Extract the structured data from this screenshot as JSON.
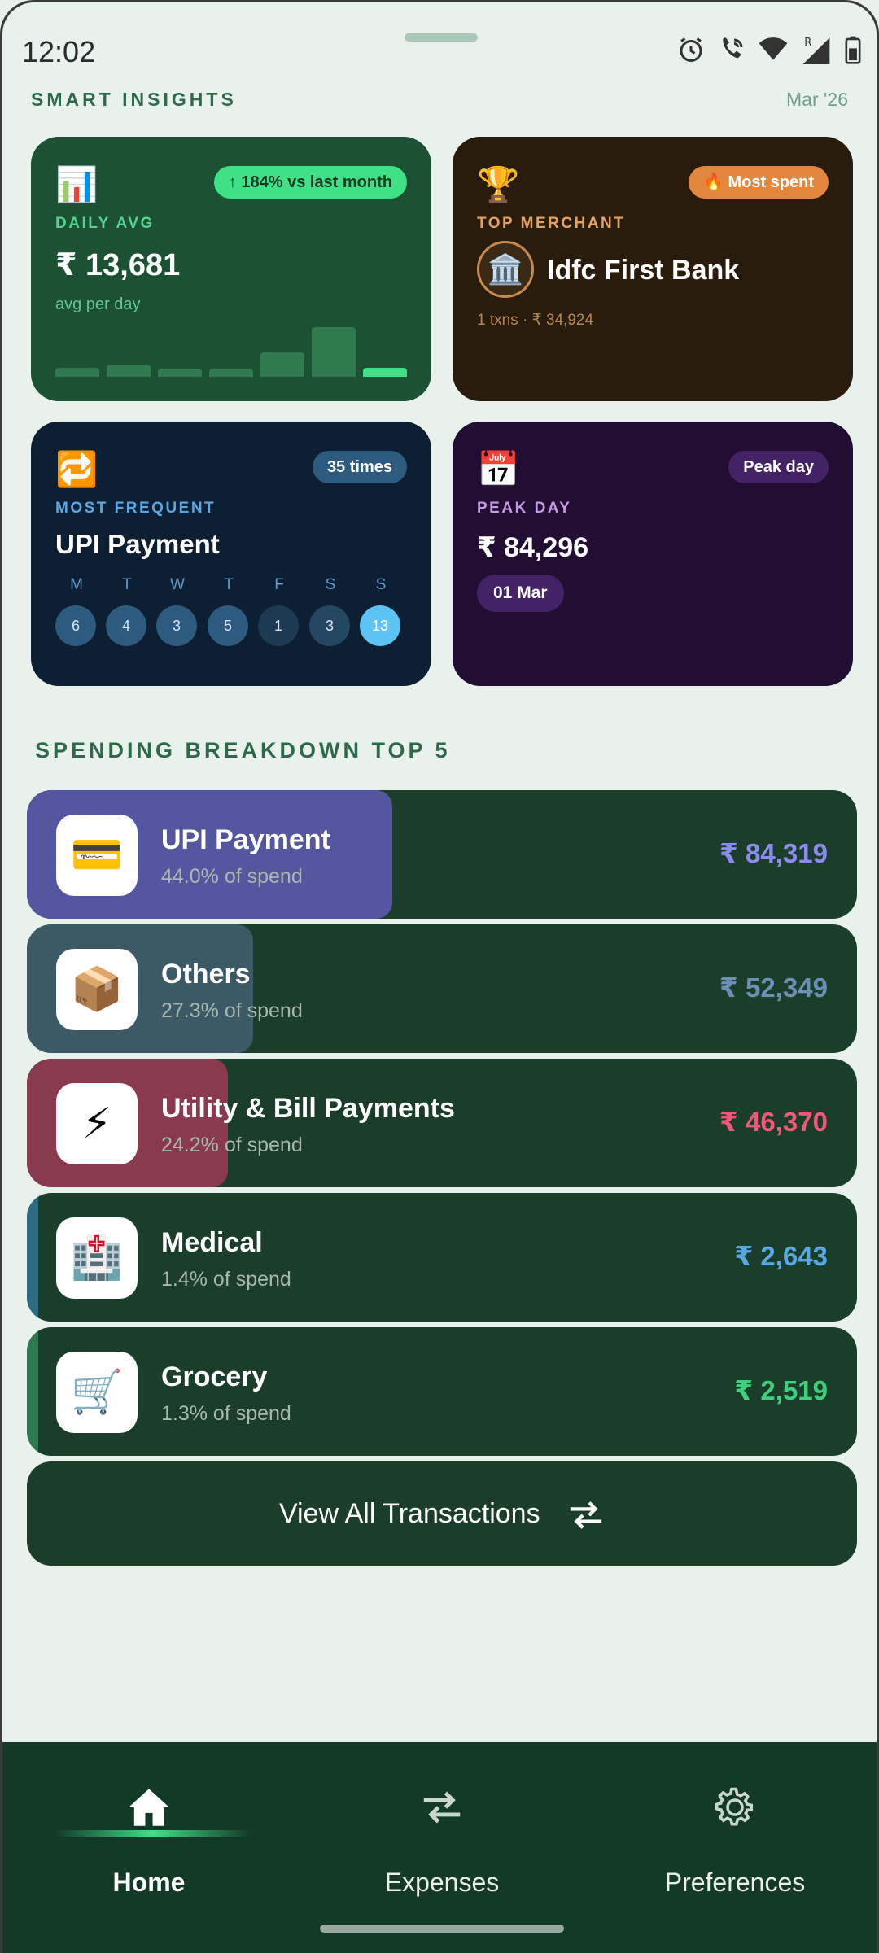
{
  "status": {
    "time": "12:02"
  },
  "insights": {
    "title": "SMART INSIGHTS",
    "month": "Mar '26",
    "daily_avg": {
      "emoji": "📊",
      "badge": "↑ 184% vs last month",
      "label": "DAILY AVG",
      "value": "₹ 13,681",
      "sub": "avg per day",
      "bar_levels": [
        0.12,
        0.17,
        0.11,
        0.11,
        0.33,
        0.68,
        0.12
      ]
    },
    "top_merchant": {
      "emoji": "🏆",
      "badge": "🔥 Most spent",
      "label": "TOP MERCHANT",
      "icon": "🏛️",
      "name": "Idfc First Bank",
      "sub": "1 txns · ₹ 34,924"
    },
    "most_frequent": {
      "emoji": "🔁",
      "badge": "35 times",
      "label": "MOST FREQUENT",
      "value": "UPI Payment",
      "days": [
        {
          "d": "M",
          "n": "6"
        },
        {
          "d": "T",
          "n": "4"
        },
        {
          "d": "W",
          "n": "3"
        },
        {
          "d": "T",
          "n": "5"
        },
        {
          "d": "F",
          "n": "1"
        },
        {
          "d": "S",
          "n": "3"
        },
        {
          "d": "S",
          "n": "13"
        }
      ]
    },
    "peak_day": {
      "emoji": "📅",
      "badge": "Peak day",
      "label": "PEAK DAY",
      "value": "₹ 84,296",
      "date": "01 Mar"
    }
  },
  "breakdown": {
    "title": "SPENDING BREAKDOWN TOP 5",
    "items": [
      {
        "icon": "💳",
        "name": "UPI Payment",
        "pct": "44.0% of spend",
        "amount": "₹ 84,319",
        "share": 0.44,
        "color": "#8b8cf2",
        "fill": "#5457a0"
      },
      {
        "icon": "📦",
        "name": "Others",
        "pct": "27.3% of spend",
        "amount": "₹ 52,349",
        "share": 0.273,
        "color": "#6b8fb5",
        "fill": "#3c5a66"
      },
      {
        "icon": "⚡",
        "name": "Utility & Bill Payments",
        "pct": "24.2% of spend",
        "amount": "₹ 46,370",
        "share": 0.242,
        "color": "#f0587a",
        "fill": "#8a3a4e"
      },
      {
        "icon": "🏥",
        "name": "Medical",
        "pct": "1.4% of spend",
        "amount": "₹ 2,643",
        "share": 0.014,
        "color": "#58a8e6",
        "fill": "#2d6a84"
      },
      {
        "icon": "🛒",
        "name": "Grocery",
        "pct": "1.3% of spend",
        "amount": "₹ 2,519",
        "share": 0.013,
        "color": "#3fcf7e",
        "fill": "#2e7a50"
      }
    ],
    "view_all": "View All Transactions"
  },
  "nav": {
    "items": [
      {
        "label": "Home",
        "active": true
      },
      {
        "label": "Expenses",
        "active": false
      },
      {
        "label": "Preferences",
        "active": false
      }
    ]
  }
}
